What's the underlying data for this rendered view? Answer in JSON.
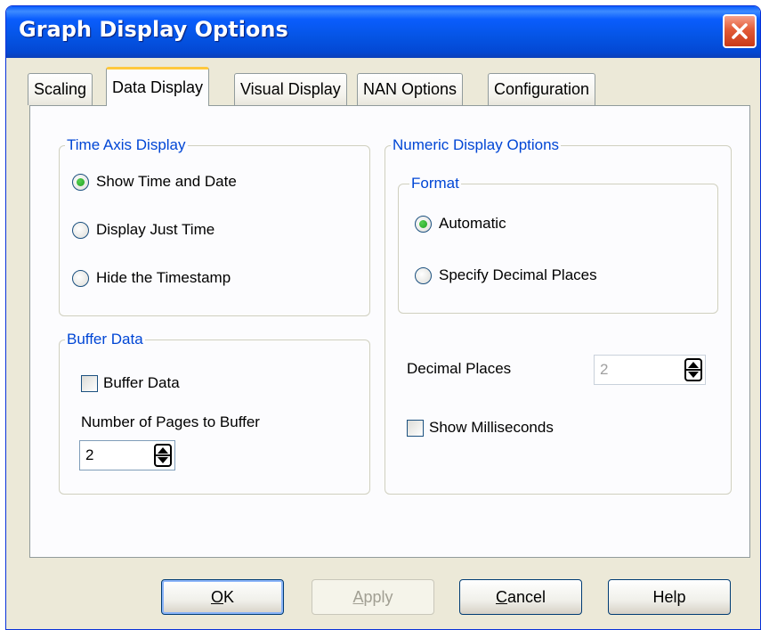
{
  "window": {
    "title": "Graph Display Options"
  },
  "tabs": [
    {
      "label": "Scaling",
      "active": false
    },
    {
      "label": "Data Display",
      "active": true
    },
    {
      "label": "Visual Display",
      "active": false
    },
    {
      "label": "NAN Options",
      "active": false
    },
    {
      "label": "Configuration",
      "active": false
    }
  ],
  "time_axis": {
    "title": "Time Axis Display",
    "options": [
      {
        "label": "Show Time and Date",
        "checked": true
      },
      {
        "label": "Display Just Time",
        "checked": false
      },
      {
        "label": "Hide the Timestamp",
        "checked": false
      }
    ]
  },
  "buffer": {
    "title": "Buffer Data",
    "checkbox_label": "Buffer Data",
    "checked": false,
    "pages_label": "Number of Pages to Buffer",
    "pages_value": "2"
  },
  "numeric": {
    "title": "Numeric Display Options",
    "format_title": "Format",
    "options": [
      {
        "label": "Automatic",
        "checked": true
      },
      {
        "label": "Specify Decimal Places",
        "checked": false
      }
    ],
    "decimal_label": "Decimal Places",
    "decimal_value": "2",
    "ms_label": "Show Milliseconds",
    "ms_checked": false
  },
  "buttons": {
    "ok": {
      "mnemonic": "O",
      "rest": "K"
    },
    "apply": {
      "mnemonic": "A",
      "rest": "pply"
    },
    "cancel": {
      "mnemonic": "C",
      "rest": "ancel"
    },
    "help": "Help"
  },
  "colors": {
    "title_bar": "#0554e4",
    "group_title": "#0046d5",
    "active_tab_highlight": "#ffc83c",
    "radio_dot": "#21a121"
  }
}
